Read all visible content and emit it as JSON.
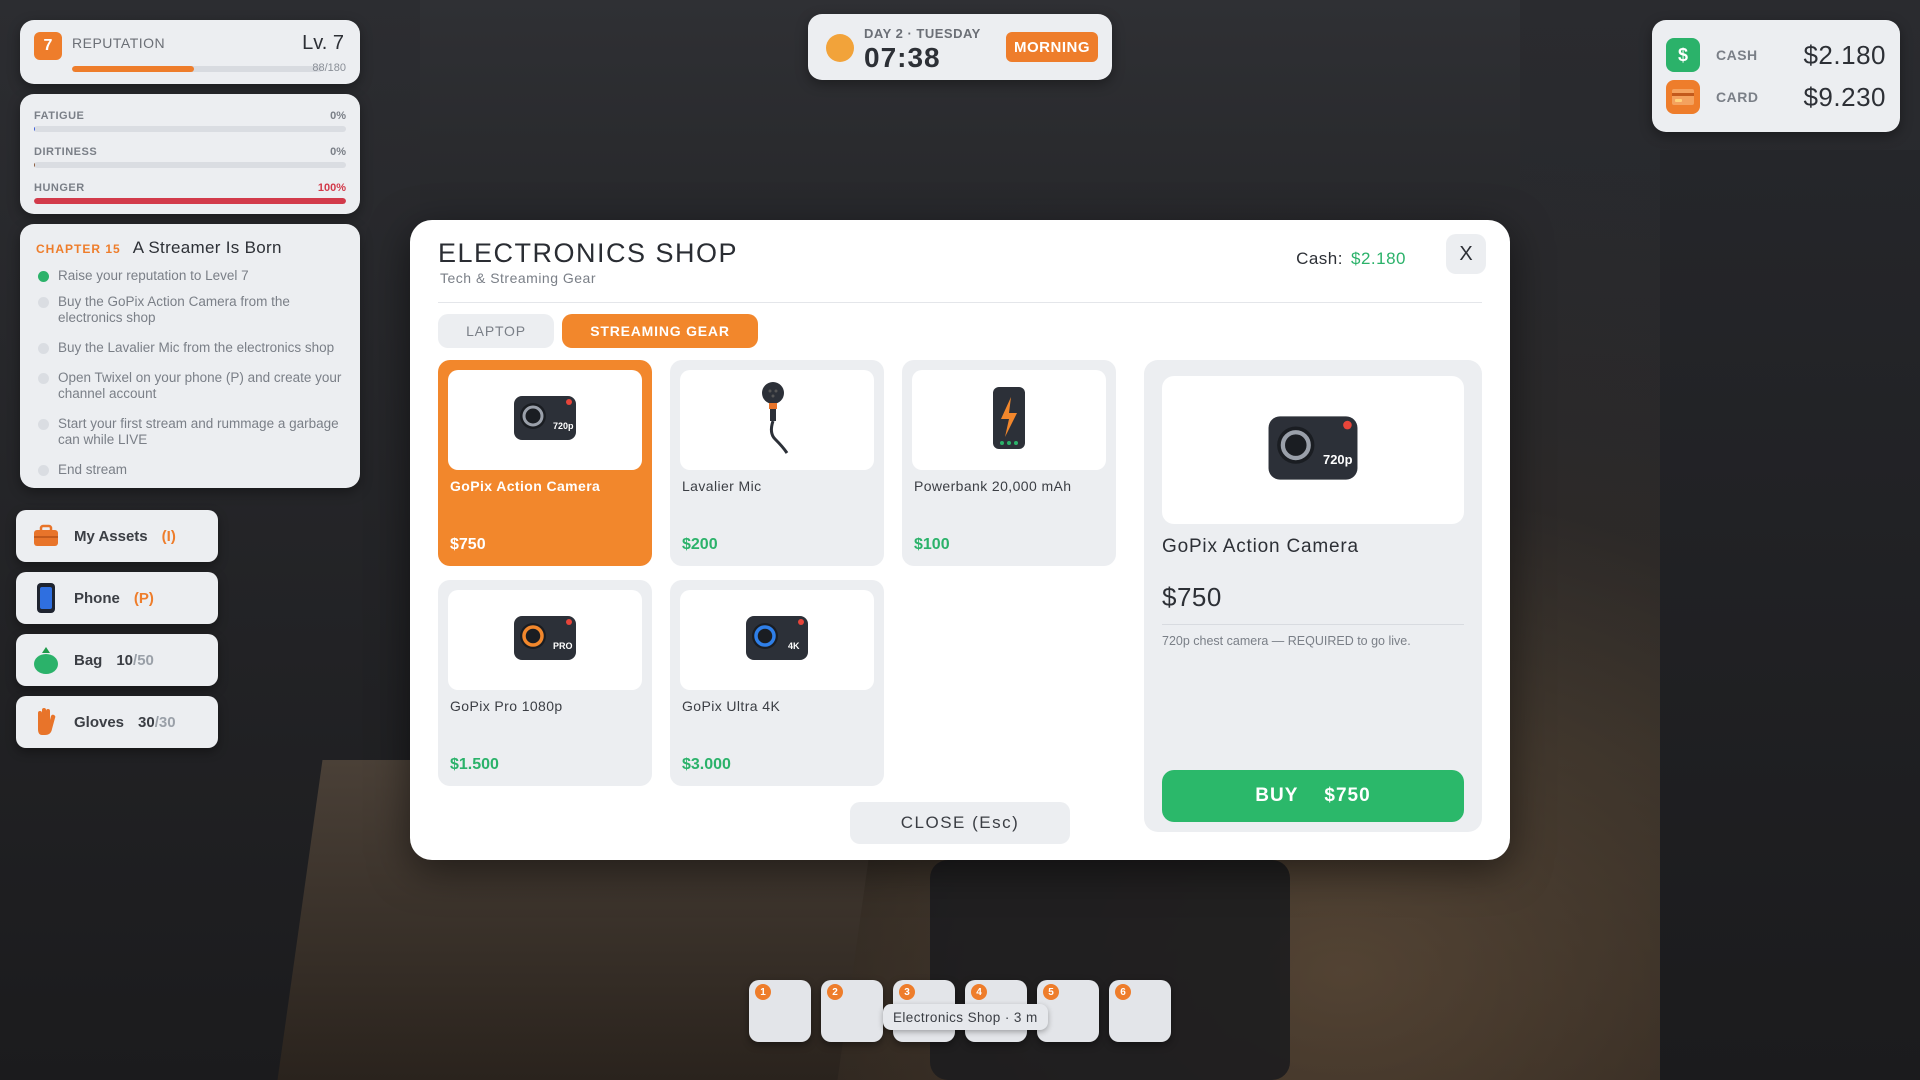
{
  "hud": {
    "reputation": {
      "badge": "7",
      "label": "REPUTATION",
      "level": "Lv. 7",
      "progress_text": "88/180",
      "progress_fraction": 0.489
    },
    "stats": [
      {
        "label": "FATIGUE",
        "value": "0%",
        "fraction": 0.0,
        "color": "#3a5bd8"
      },
      {
        "label": "DIRTINESS",
        "value": "0%",
        "fraction": 0.0,
        "color": "#8a5a3a"
      },
      {
        "label": "HUNGER",
        "value": "100%",
        "fraction": 1.0,
        "color": "#d23a4a"
      }
    ],
    "quest": {
      "chapter": "CHAPTER 15",
      "title": "A Streamer Is Born",
      "items": [
        {
          "text": "Raise your reputation to Level 7",
          "done": true
        },
        {
          "text": "Buy the GoPix Action Camera from the electronics shop",
          "done": false
        },
        {
          "text": "Buy the Lavalier Mic from the electronics shop",
          "done": false
        },
        {
          "text": "Open Twixel on your phone (P) and create your channel account",
          "done": false
        },
        {
          "text": "Start your first stream and rummage a garbage can while LIVE",
          "done": false
        },
        {
          "text": "End stream",
          "done": false
        }
      ]
    },
    "side_buttons": {
      "assets": {
        "label": "My Assets",
        "key": "(I)",
        "icon": "briefcase-icon"
      },
      "phone": {
        "label": "Phone",
        "key": "(P)",
        "icon": "phone-icon"
      },
      "bag": {
        "label": "Bag",
        "count": "10",
        "max": "/50",
        "icon": "bag-icon"
      },
      "gloves": {
        "label": "Gloves",
        "count": "30",
        "max": "/30",
        "icon": "glove-icon"
      }
    },
    "clock": {
      "day": "DAY 2 · TUESDAY",
      "time": "07:38",
      "phase": "MORNING"
    },
    "money": {
      "cash_label": "CASH",
      "cash_value": "$2.180",
      "card_label": "CARD",
      "card_value": "$9.230"
    }
  },
  "shop": {
    "title": "ELECTRONICS SHOP",
    "subtitle": "Tech & Streaming Gear",
    "cash_label": "Cash:",
    "cash_value": "$2.180",
    "close_x": "X",
    "tabs": [
      "LAPTOP",
      "STREAMING GEAR"
    ],
    "active_tab": "STREAMING GEAR",
    "items": [
      {
        "name": "GoPix Action Camera",
        "price": "$750",
        "icon": "camera-icon",
        "badge": "720p",
        "selected": true
      },
      {
        "name": "Lavalier Mic",
        "price": "$200",
        "icon": "microphone-icon"
      },
      {
        "name": "Powerbank 20,000 mAh",
        "price": "$100",
        "icon": "powerbank-icon"
      },
      {
        "name": "GoPix Pro 1080p",
        "price": "$1.500",
        "icon": "camera-icon",
        "badge": "PRO"
      },
      {
        "name": "GoPix Ultra 4K",
        "price": "$3.000",
        "icon": "camera-icon",
        "badge": "4K"
      }
    ],
    "detail": {
      "name": "GoPix Action Camera",
      "price": "$750",
      "badge": "720p",
      "description": "720p chest camera — REQUIRED to go live.",
      "buy_label": "BUY",
      "buy_price": "$750"
    },
    "close_button": "CLOSE  (Esc)"
  },
  "hotbar": {
    "slots": [
      "1",
      "2",
      "3",
      "4",
      "5",
      "6"
    ],
    "tooltip": "Electronics Shop · 3 m"
  },
  "colors": {
    "accent": "#f2872c",
    "money_green": "#2bb26a",
    "buy_green": "#2bb86a"
  }
}
